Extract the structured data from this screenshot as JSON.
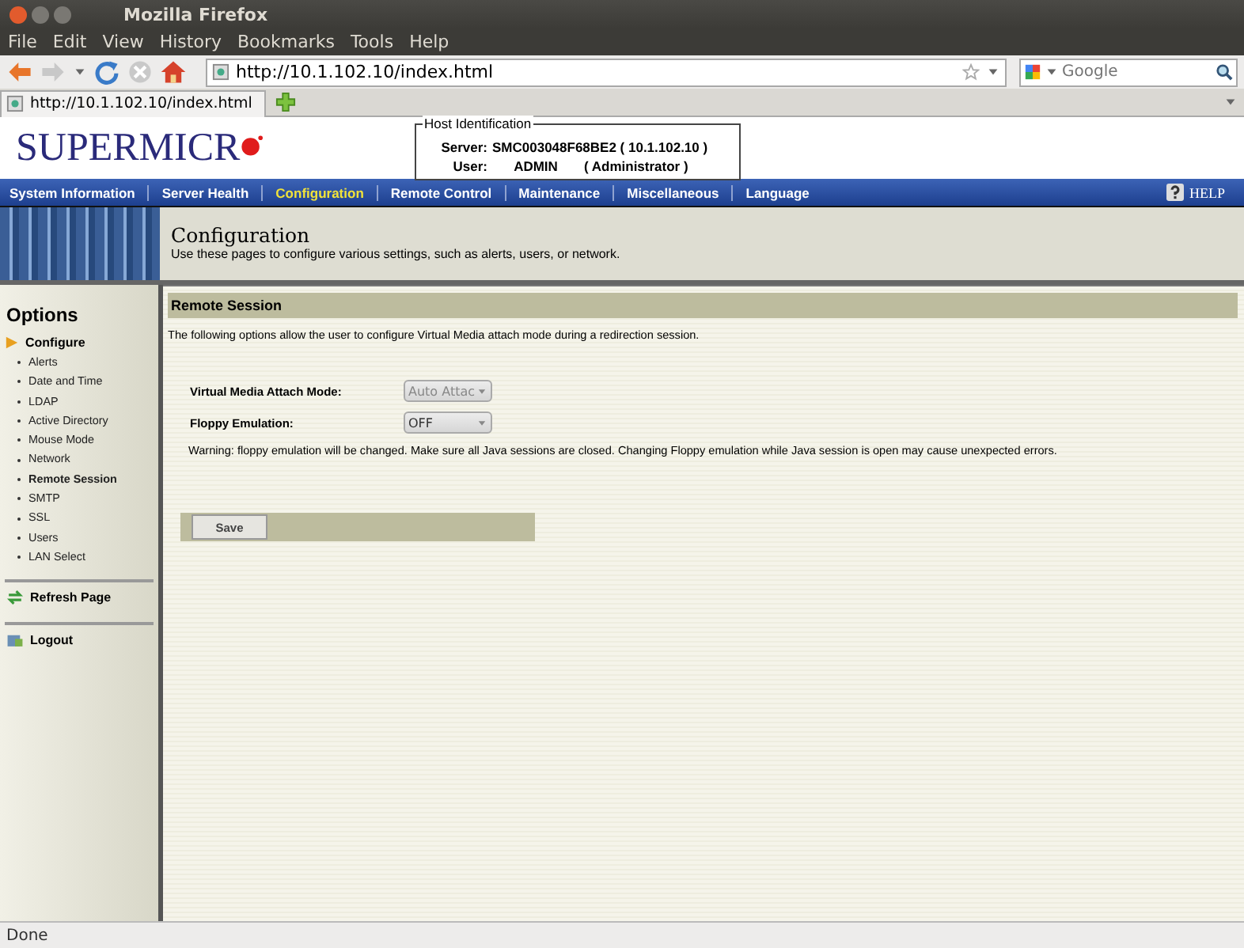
{
  "window": {
    "title": "Mozilla Firefox"
  },
  "menu": [
    "File",
    "Edit",
    "View",
    "History",
    "Bookmarks",
    "Tools",
    "Help"
  ],
  "address": {
    "value": "http://10.1.102.10/index.html"
  },
  "search": {
    "placeholder": "Google"
  },
  "tab": {
    "label": "http://10.1.102.10/index.html"
  },
  "logo": {
    "text": "SUPERMICR"
  },
  "host": {
    "legend": "Host Identification",
    "server_label": "Server:",
    "server": "SMC003048F68BE2 (   10.1.102.10   )",
    "user_label": "User:",
    "user": "ADMIN",
    "role": "( Administrator )"
  },
  "nav": [
    {
      "label": "System Information",
      "selected": false
    },
    {
      "label": "Server Health",
      "selected": false
    },
    {
      "label": "Configuration",
      "selected": true
    },
    {
      "label": "Remote Control",
      "selected": false
    },
    {
      "label": "Maintenance",
      "selected": false
    },
    {
      "label": "Miscellaneous",
      "selected": false
    },
    {
      "label": "Language",
      "selected": false
    }
  ],
  "help": "HELP",
  "banner": {
    "title": "Configuration",
    "subtitle": "Use these pages to configure various settings, such as alerts, users, or network."
  },
  "sidebar": {
    "title": "Options",
    "section": "Configure",
    "items": [
      {
        "label": "Alerts",
        "selected": false
      },
      {
        "label": "Date and Time",
        "selected": false
      },
      {
        "label": "LDAP",
        "selected": false
      },
      {
        "label": "Active Directory",
        "selected": false
      },
      {
        "label": "Mouse Mode",
        "selected": false
      },
      {
        "label": "Network",
        "selected": false
      },
      {
        "label": "Remote Session",
        "selected": true
      },
      {
        "label": "SMTP",
        "selected": false
      },
      {
        "label": "SSL",
        "selected": false
      },
      {
        "label": "Users",
        "selected": false
      },
      {
        "label": "LAN Select",
        "selected": false
      }
    ],
    "refresh": "Refresh Page",
    "logout": "Logout"
  },
  "content": {
    "heading": "Remote Session",
    "intro": "The following options allow the user to configure Virtual Media attach mode during a redirection session.",
    "fields": [
      {
        "label": "Virtual Media Attach Mode:",
        "value": "Auto Attac",
        "disabled": true
      },
      {
        "label": "Floppy Emulation:",
        "value": "OFF",
        "disabled": false
      }
    ],
    "warning": "Warning: floppy emulation will be changed. Make sure all Java sessions are closed. Changing Floppy emulation while Java session is open may cause unexpected errors.",
    "save": "Save"
  },
  "status_bar": "Done"
}
